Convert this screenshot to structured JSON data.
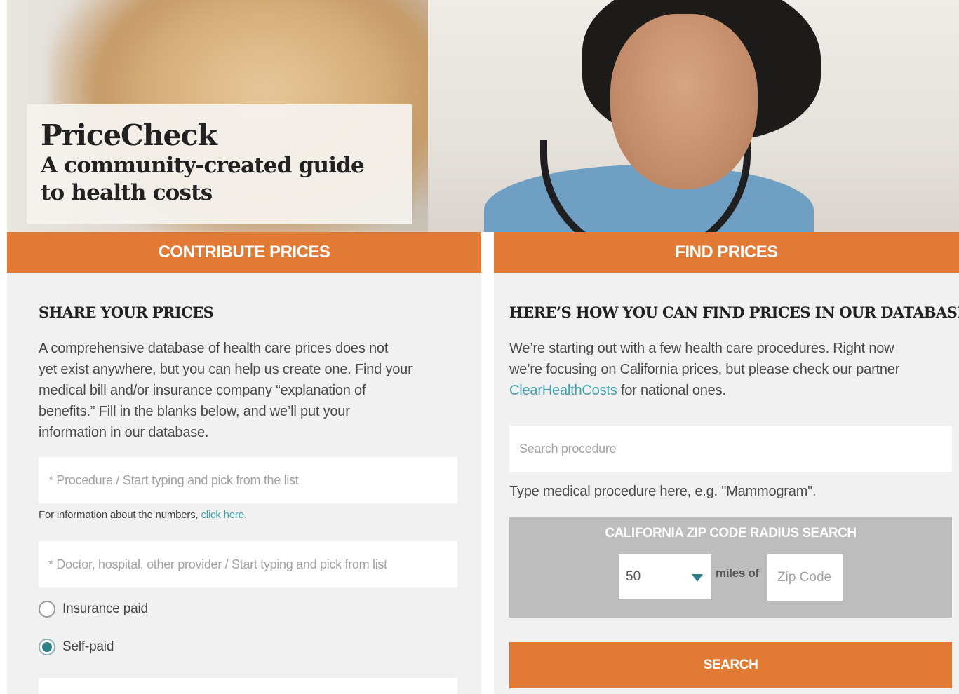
{
  "hero": {
    "title": "PriceCheck",
    "subtitle_line1": "A community-created guide",
    "subtitle_line2": "to health costs"
  },
  "tabs": {
    "contribute_label": "CONTRIBUTE PRICES",
    "find_label": "FIND PRICES"
  },
  "contribute": {
    "heading": "SHARE YOUR PRICES",
    "intro_lines": [
      "A comprehensive database of health care prices does not",
      "yet exist anywhere, but you can help us create one. Find your",
      "medical bill and/or insurance company “explanation of",
      "benefits.” Fill in the blanks below, and we’ll put your",
      "information in our database."
    ],
    "procedure_placeholder": "* Procedure / Start typing and pick from the list",
    "numbers_info": "For information about the numbers,",
    "numbers_link": "click here.",
    "provider_placeholder": "* Doctor, hospital, other provider / Start typing and pick from list",
    "payment_options": [
      {
        "label": "Insurance paid",
        "checked": false
      },
      {
        "label": "Self-paid",
        "checked": true
      }
    ]
  },
  "find": {
    "heading": "HERE’S HOW YOU CAN FIND PRICES IN OUR DATABASE",
    "intro_line1": "We’re starting out with a few health care procedures. Right now",
    "intro_line2": "we’re focusing on California prices, but please check our partner",
    "intro_link": "ClearHealthCosts",
    "intro_line3_rest": " for national ones.",
    "search_placeholder": "Search procedure",
    "search_hint": "Type medical procedure here, e.g. \"Mammogram\".",
    "zip_title": "CALIFORNIA ZIP CODE RADIUS SEARCH",
    "radius_value": "50",
    "miles_label": "miles of",
    "zip_placeholder": "Zip Code",
    "search_button": "SEARCH"
  },
  "colors": {
    "accent": "#e07a35",
    "link": "#3fa3ad",
    "panel_bg": "#f1f1f1",
    "zip_box_bg": "#bdbdbd"
  }
}
